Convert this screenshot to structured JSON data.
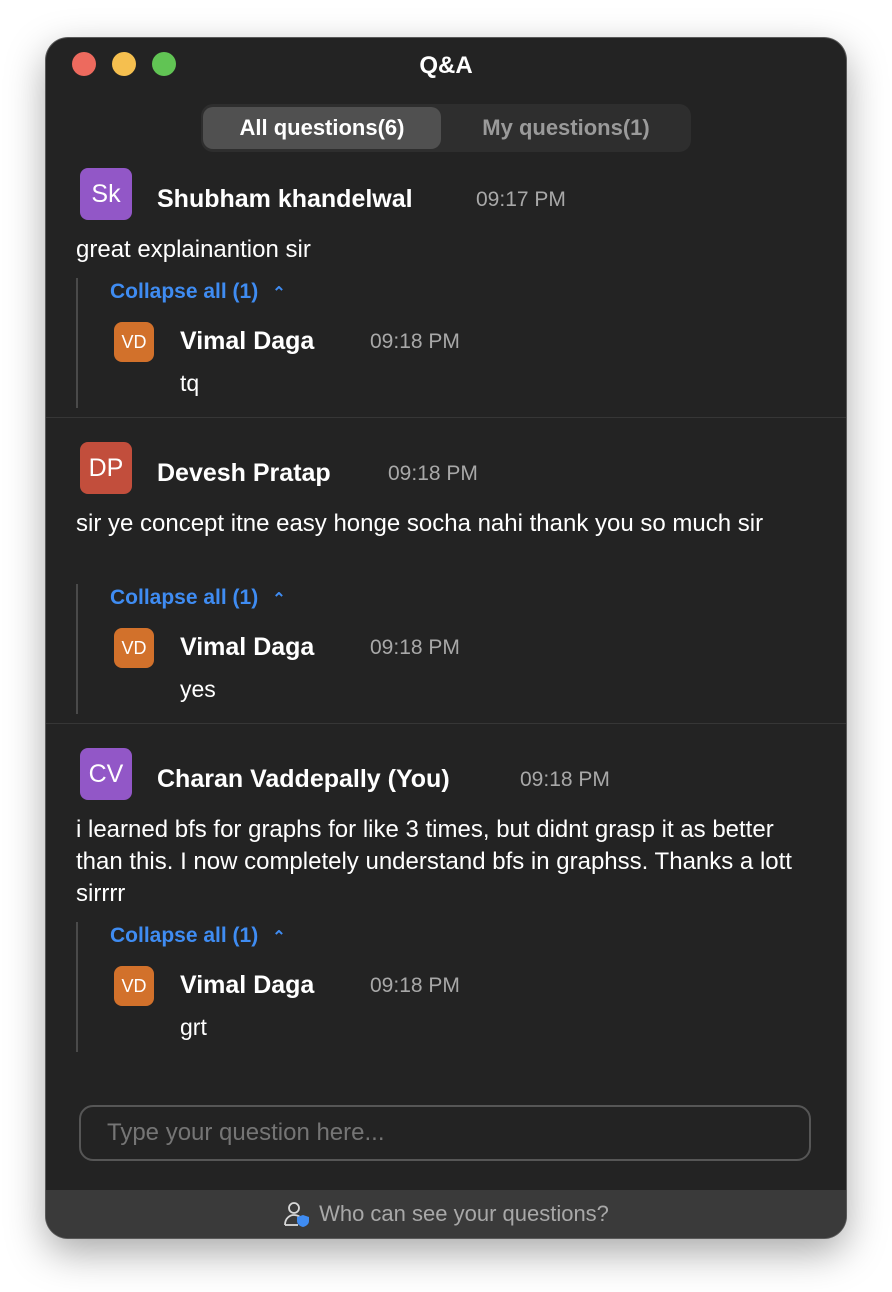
{
  "window": {
    "title": "Q&A"
  },
  "tabs": [
    {
      "label": "All questions(6)",
      "active": true
    },
    {
      "label": "My questions(1)",
      "active": false
    }
  ],
  "threads": [
    {
      "avatar": {
        "initials": "Sk",
        "color": "#9257c7"
      },
      "author": "Shubham khandelwal",
      "time": "09:17 PM",
      "text": "great explainantion sir",
      "collapse_label": "Collapse all (1)",
      "reply": {
        "avatar": {
          "initials": "VD",
          "color": "#d2712b"
        },
        "author": "Vimal Daga",
        "time": "09:18 PM",
        "text": "tq"
      }
    },
    {
      "avatar": {
        "initials": "DP",
        "color": "#c24e3c"
      },
      "author": "Devesh Pratap",
      "time": "09:18 PM",
      "text": "sir ye concept itne easy honge socha nahi thank you so much sir",
      "collapse_label": "Collapse all (1)",
      "reply": {
        "avatar": {
          "initials": "VD",
          "color": "#d2712b"
        },
        "author": "Vimal Daga",
        "time": "09:18 PM",
        "text": "yes"
      }
    },
    {
      "avatar": {
        "initials": "CV",
        "color": "#9257c7"
      },
      "author": "Charan Vaddepally (You)",
      "time": "09:18 PM",
      "text": "i learned bfs for graphs for like 3 times, but didnt grasp it as better than this. I now completely understand bfs in graphss. Thanks a lott sirrrr",
      "collapse_label": "Collapse all (1)",
      "reply": {
        "avatar": {
          "initials": "VD",
          "color": "#d2712b"
        },
        "author": "Vimal Daga",
        "time": "09:18 PM",
        "text": "grt"
      }
    }
  ],
  "input": {
    "placeholder": "Type your question here..."
  },
  "footer": {
    "text": "Who can see your questions?",
    "icon": "person-shield-icon"
  }
}
